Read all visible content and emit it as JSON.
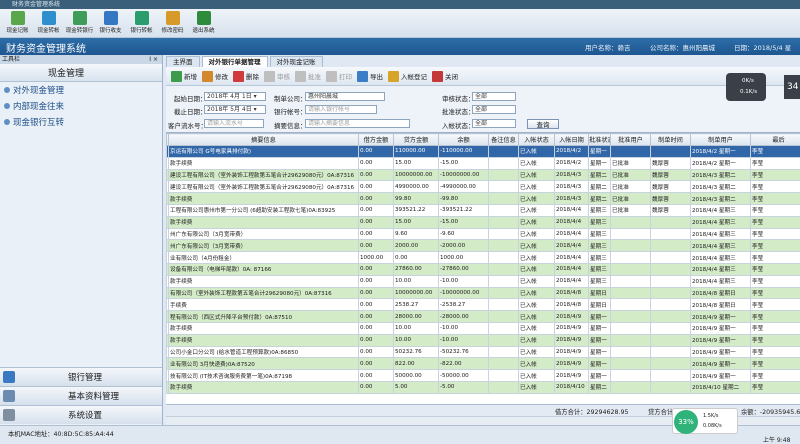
{
  "titlebar": {
    "text": "财务资金管理系统"
  },
  "toolbar": [
    {
      "label": "现金记账",
      "color": "#5aa64b",
      "icon": "cash-icon"
    },
    {
      "label": "现金转帐",
      "color": "#2f8fce",
      "icon": "transfer-icon"
    },
    {
      "label": "现金转银行",
      "color": "#3e9d58",
      "icon": "bank-transfer-icon"
    },
    {
      "label": "银行收支",
      "color": "#3478c4",
      "icon": "bank-icon"
    },
    {
      "label": "银行转帐",
      "color": "#2b9d6c",
      "icon": "bank-account-icon"
    },
    {
      "label": "修改密码",
      "color": "#d79a2a",
      "icon": "lock-icon"
    },
    {
      "label": "退出系统",
      "color": "#2e8b3c",
      "icon": "exit-icon"
    }
  ],
  "banner": {
    "title": "财务资金管理系统",
    "user": "用户名称：赖吉",
    "company": "公司名称：惠州阳晨城",
    "date": "日期：2018/5/4 星"
  },
  "leftpanel": {
    "header": "工具栏",
    "pin": "Ⅰ ×",
    "category": "现金管理",
    "nav": [
      {
        "label": "对外现金管理"
      },
      {
        "label": "内部现金往来"
      },
      {
        "label": "现金银行互转"
      }
    ],
    "bottom": [
      {
        "label": "银行管理",
        "color": "#3a78c2"
      },
      {
        "label": "基本资料管理",
        "color": "#6c8bb0"
      },
      {
        "label": "系统设置",
        "color": "#7f8ea0"
      }
    ]
  },
  "tabs": [
    {
      "label": "主界面"
    },
    {
      "label": "对外银行单据管理"
    },
    {
      "label": "对外现金记账"
    }
  ],
  "maintool": [
    {
      "label": "新增",
      "color": "#3d9c4a",
      "dis": false,
      "icon": "add-icon"
    },
    {
      "label": "修改",
      "color": "#d2892e",
      "dis": false,
      "icon": "edit-icon"
    },
    {
      "label": "删除",
      "color": "#cf3a3a",
      "dis": false,
      "icon": "delete-icon"
    },
    {
      "label": "审核",
      "color": "#bfbfbf",
      "dis": true,
      "icon": "audit-icon"
    },
    {
      "label": "批准",
      "color": "#bfbfbf",
      "dis": true,
      "icon": "approve-icon"
    },
    {
      "label": "打印",
      "color": "#bfbfbf",
      "dis": true,
      "icon": "print-icon"
    },
    {
      "label": "导出",
      "color": "#3b7dc6",
      "dis": false,
      "icon": "export-icon"
    },
    {
      "label": "入帐登记",
      "color": "#d7a42a",
      "dis": false,
      "icon": "register-icon"
    },
    {
      "label": "关闭",
      "color": "#c43838",
      "dis": false,
      "icon": "close-icon"
    }
  ],
  "filter": {
    "start_label": "起始日期：",
    "start_val": "2018年 4月 1日 ▾",
    "end_label": "截止日期：",
    "end_val": "2018年 5月 4日 ▾",
    "cust_label": "客户流水号：",
    "cust_ph": "请输入流水号",
    "company_label": "制单公司：",
    "company_val": "惠州阳晨城",
    "account_label": "银行帐号：",
    "account_ph": "请输入银行帐号",
    "summary_label": "摘要信息：",
    "summary_ph": "请输入摘要信息",
    "audit_label": "审核状态：",
    "audit_val": "全部",
    "approve_label": "批准状态：",
    "approve_val": "全部",
    "entry_label": "入帐状态：",
    "entry_val": "全部",
    "query": "查询"
  },
  "columns": [
    "",
    "摘要信息",
    "借方金额",
    "贷方金额",
    "余额",
    "备注信息",
    "入帐状态",
    "入帐日期",
    "批准状态",
    "批准用户",
    "制单时间",
    "制单用户",
    "最后"
  ],
  "rows": [
    [
      "",
      "京运有限公司 G号电家具排付款)",
      "0.00",
      "110000.00",
      "-110000.00",
      "",
      "已入帐",
      "2018/4/2",
      "星期一",
      "",
      "",
      "2018/4/2 星期一",
      "李莹"
    ],
    [
      "",
      "款手续费",
      "0.00",
      "15.00",
      "-15.00",
      "",
      "已入帐",
      "2018/4/2",
      "星期一",
      "已批准",
      "魏厚蓉",
      "2018/4/2 星期一",
      "李莹"
    ],
    [
      "",
      "建设工程有限公司（室外装饰工程款第五笔合计29629080元）0A:87316",
      "0.00",
      "10000000.00",
      "-10000000.00",
      "",
      "已入帐",
      "2018/4/3",
      "星期二",
      "已批准",
      "魏厚蓉",
      "2018/4/3 星期二",
      "李莹"
    ],
    [
      "",
      "建设工程有限公司（室外装饰工程款第五笔合计29629080元）0A:87316",
      "0.00",
      "4990000.00",
      "-4990000.00",
      "",
      "已入帐",
      "2018/4/3",
      "星期二",
      "已批准",
      "魏厚蓉",
      "2018/4/3 星期二",
      "李莹"
    ],
    [
      "",
      "款手续费",
      "0.00",
      "99.80",
      "-99.80",
      "",
      "已入帐",
      "2018/4/3",
      "星期二",
      "已批准",
      "魏厚蓉",
      "2018/4/3 星期二",
      "李莹"
    ],
    [
      "",
      "工程有限公司惠州市第一分公司 (6超助安装工程款七笔)0A:83925",
      "0.00",
      "393521.22",
      "-393521.22",
      "",
      "已入帐",
      "2018/4/4",
      "星期三",
      "已批准",
      "魏厚蓉",
      "2018/4/4 星期三",
      "李莹"
    ],
    [
      "",
      "款手续费",
      "0.00",
      "15.00",
      "-15.00",
      "",
      "已入帐",
      "2018/4/4",
      "星期三",
      "",
      "",
      "2018/4/4 星期三",
      "李莹"
    ],
    [
      "",
      "州广东有限公司（3月宽带费）",
      "0.00",
      "9.60",
      "-9.60",
      "",
      "已入帐",
      "2018/4/4",
      "星期三",
      "",
      "",
      "2018/4/4 星期三",
      "李莹"
    ],
    [
      "",
      "州广东有限公司（3月宽带费）",
      "0.00",
      "2000.00",
      "-2000.00",
      "",
      "已入帐",
      "2018/4/4",
      "星期三",
      "",
      "",
      "2018/4/4 星期三",
      "李莹"
    ],
    [
      "",
      "业有限公司（4月份租金）",
      "1000.00",
      "0.00",
      "1000.00",
      "",
      "已入帐",
      "2018/4/4",
      "星期三",
      "",
      "",
      "2018/4/4 星期三",
      "李莹"
    ],
    [
      "",
      "设备有限公司（电梯年尾款）0A: 87166",
      "0.00",
      "27860.00",
      "-27860.00",
      "",
      "已入帐",
      "2018/4/4",
      "星期三",
      "",
      "",
      "2018/4/4 星期三",
      "李莹"
    ],
    [
      "",
      "款手续费",
      "0.00",
      "10.00",
      "-10.00",
      "",
      "已入帐",
      "2018/4/4",
      "星期三",
      "",
      "",
      "2018/4/4 星期三",
      "李莹"
    ],
    [
      "",
      "有限公司（室外装饰工程款第五笔合计29629080元）0A:87316",
      "0.00",
      "10000000.00",
      "-10000000.00",
      "",
      "已入帐",
      "2018/4/8",
      "星期日",
      "",
      "",
      "2018/4/8 星期日",
      "李莹"
    ],
    [
      "",
      "手续费",
      "0.00",
      "2538.27",
      "-2538.27",
      "",
      "已入帐",
      "2018/4/8",
      "星期日",
      "",
      "",
      "2018/4/8 星期日",
      "李莹"
    ],
    [
      "",
      "程有限公司（西区式升降平台预付款）0A:87510",
      "0.00",
      "28000.00",
      "-28000.00",
      "",
      "已入帐",
      "2018/4/9",
      "星期一",
      "",
      "",
      "2018/4/9 星期一",
      "李莹"
    ],
    [
      "",
      "款手续费",
      "0.00",
      "10.00",
      "-10.00",
      "",
      "已入帐",
      "2018/4/9",
      "星期一",
      "",
      "",
      "2018/4/9 星期一",
      "李莹"
    ],
    [
      "",
      "款手续费",
      "0.00",
      "10.00",
      "-10.00",
      "",
      "已入帐",
      "2018/4/9",
      "星期一",
      "",
      "",
      "2018/4/9 星期一",
      "李莹"
    ],
    [
      "",
      "公司小金口分公司 (给水管道工程预算款)0A:86850",
      "0.00",
      "50232.76",
      "-50232.76",
      "",
      "已入帐",
      "2018/4/9",
      "星期一",
      "",
      "",
      "2018/4/9 星期一",
      "李莹"
    ],
    [
      "",
      "业有限公司 3月快递费)0A:87520",
      "0.00",
      "822.00",
      "-822.00",
      "",
      "已入帐",
      "2018/4/9",
      "星期一",
      "",
      "",
      "2018/4/9 星期一",
      "李莹"
    ],
    [
      "",
      "技有限公司 (IT技术咨询服务费第一笔)0A:87198",
      "0.00",
      "50000.00",
      "-50000.00",
      "",
      "已入帐",
      "2018/4/9",
      "星期一",
      "",
      "",
      "2018/4/9 星期一",
      "李莹"
    ],
    [
      "",
      "款手续费",
      "0.00",
      "5.00",
      "-5.00",
      "",
      "已入帐",
      "2018/4/10",
      "星期二",
      "",
      "",
      "2018/4/10 星期二",
      "李莹"
    ]
  ],
  "totals": {
    "debit": "借方合计：29294628.95",
    "credit": "贷方合计：32325574.56",
    "balance": "余额：-20935945.61"
  },
  "status": {
    "mac": "本机MAC地址：40:8D:5C:85:A4:44",
    "speed_pct": "33%",
    "up": "1.5K/s",
    "down": "0.08K/s",
    "time": "上午 9:48"
  },
  "netwidget": {
    "up": "0K/s",
    "down": "0.1K/s",
    "num": "34"
  }
}
